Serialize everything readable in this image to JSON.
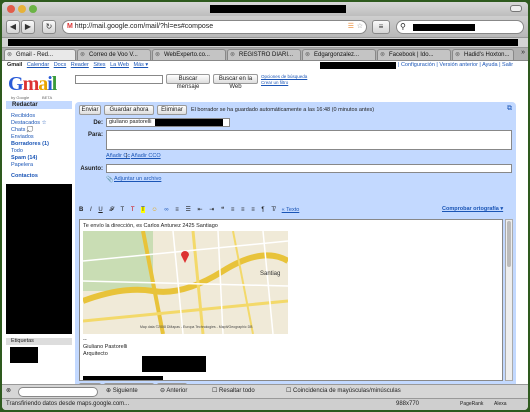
{
  "browser": {
    "url": "http://mail.google.com/mail/?hl=es#compose",
    "tabs": [
      "Gmail - Red...",
      "Correo de Voo V...",
      "WebExperto.co...",
      "REGISTRO DIARI...",
      "Edgargonzalez...",
      "Facebook | Ido...",
      "Hadid's Hoxton..."
    ]
  },
  "gmail": {
    "nav_links": [
      "Gmail",
      "Calendar",
      "Docs",
      "Reader",
      "Sites",
      "La Web",
      "Más ▾"
    ],
    "right_links": "| Configuración | Versión anterior | Ayuda | Salir",
    "logo_sub": "by Google",
    "logo_beta": "BETA",
    "search_mail_btn": "Buscar mensaje",
    "search_web_btn": "Buscar en la Web",
    "search_options": "Opciones de búsqueda",
    "create_filter": "Crear un filtro",
    "compose": "Redactar",
    "sidebar": [
      "Recibidos",
      "Destacados ☆",
      "Chats 💭",
      "Enviados",
      "Borradores (1)",
      "Todo",
      "Spam (14)",
      "Papelera"
    ],
    "contacts": "Contactos",
    "labels": "Etiquetas",
    "btn_send": "Enviar",
    "btn_save": "Guardar ahora",
    "btn_delete": "Eliminar",
    "autosave": "El borrador se ha guardado automáticamente a las 16:48 (0 minutos antes)",
    "label_from": "De:",
    "from_value": "giuliano pastorelli",
    "label_to": "Para:",
    "add_cc": "Añadir Cc",
    "add_bcc": "Añadir CCO",
    "label_subject": "Asunto:",
    "attach": "Adjuntar un archivo",
    "plain_text": "« Texto",
    "spellcheck": "Comprobar ortografía ▾",
    "body_line1": "Te envío la dirección, es Carlos Antunez 2425 Santiago",
    "map_city": "Santiag",
    "map_credit": "Map data ©2008 DMapas - Europa Technologies - MapIt/Geographic DB",
    "signature_name": "Giuliano Pastorelli",
    "signature_title": "Arquitecto"
  },
  "findbar": {
    "next": "Siguiente",
    "prev": "Anterior",
    "highlight": "Resaltar todo",
    "match_case": "Coincidencia de mayúsculas/minúsculas"
  },
  "status": {
    "text": "Transfiriendo datos desde maps.google.com...",
    "size": "988x770",
    "pagerank": "PageRank",
    "alexa": "Alexa"
  },
  "colors": {
    "panel": "#c3d9ff",
    "link": "#1a55b6"
  }
}
